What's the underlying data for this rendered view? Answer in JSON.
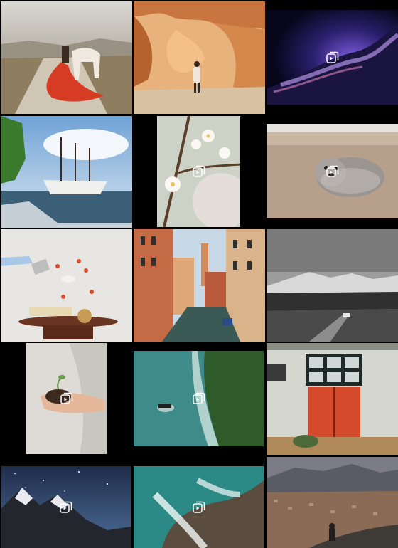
{
  "gallery": {
    "items": [
      {
        "subject": "woman-red-dress-horse",
        "multi_media": false
      },
      {
        "subject": "sandstone-canyon-person",
        "multi_media": false
      },
      {
        "subject": "purple-particle-wave",
        "multi_media": true
      },
      {
        "subject": "tall-ship-harbor",
        "multi_media": false
      },
      {
        "subject": "cherry-blossom-branch",
        "multi_media": true
      },
      {
        "subject": "seal-pup-beach",
        "multi_media": true
      },
      {
        "subject": "floating-breakfast-still-life",
        "multi_media": false
      },
      {
        "subject": "venice-canal",
        "multi_media": false
      },
      {
        "subject": "mountain-highway-bw",
        "multi_media": false
      },
      {
        "subject": "hands-holding-seedling",
        "multi_media": true
      },
      {
        "subject": "aerial-surfer-ocean",
        "multi_media": true
      },
      {
        "subject": "building-red-door",
        "multi_media": false
      },
      {
        "subject": "starry-sky-mountains",
        "multi_media": true
      },
      {
        "subject": "aerial-waves-rocks",
        "multi_media": true
      },
      {
        "subject": "city-valley-mountains",
        "multi_media": false
      }
    ],
    "badge_icon": "multiple-media-icon",
    "badge_color": "#ffffff"
  }
}
